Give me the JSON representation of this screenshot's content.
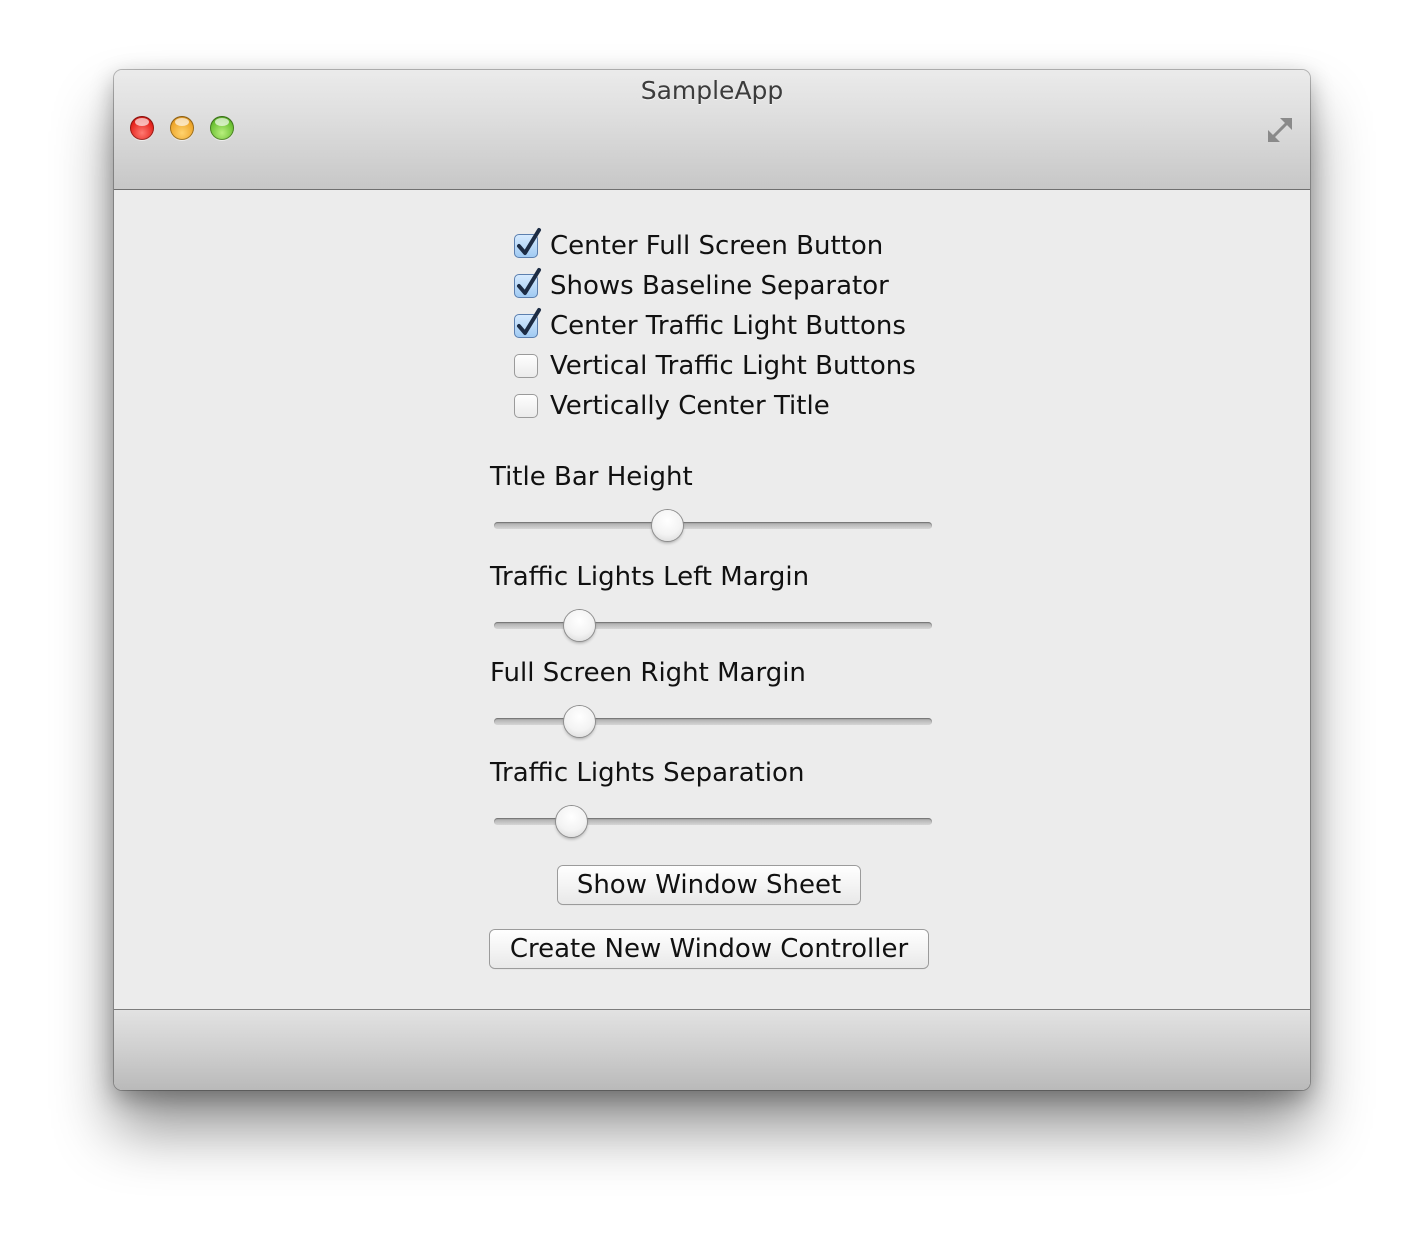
{
  "window": {
    "title": "SampleApp"
  },
  "titlebar": {
    "traffic_lights": [
      "close",
      "minimize",
      "zoom"
    ],
    "fullscreen_icon": "fullscreen-arrows-icon"
  },
  "checkboxes": [
    {
      "label": "Center Full Screen Button",
      "checked": true
    },
    {
      "label": "Shows Baseline Separator",
      "checked": true
    },
    {
      "label": "Center Traffic Light Buttons",
      "checked": true
    },
    {
      "label": "Vertical Traffic Light Buttons",
      "checked": false
    },
    {
      "label": "Vertically Center Title",
      "checked": false
    }
  ],
  "sliders": [
    {
      "label": "Title Bar Height",
      "value": 0.395
    },
    {
      "label": "Traffic Lights Left Margin",
      "value": 0.195
    },
    {
      "label": "Full Screen Right Margin",
      "value": 0.195
    },
    {
      "label": "Traffic Lights Separation",
      "value": 0.175
    }
  ],
  "buttons": {
    "show_sheet": "Show Window Sheet",
    "new_controller": "Create New Window Controller"
  },
  "colors": {
    "close": "#e5231c",
    "minimize": "#eea62b",
    "zoom": "#6cc133",
    "check_fill": "#9ec9f2",
    "check_mark": "#1d2c44"
  }
}
